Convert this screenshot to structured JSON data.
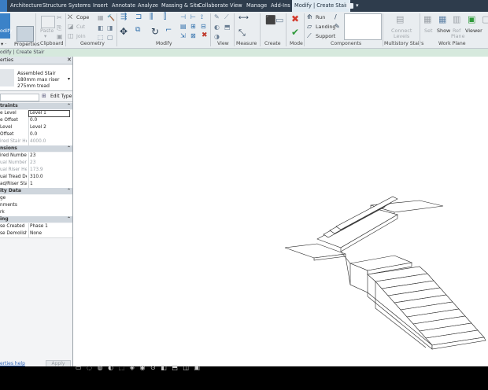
{
  "tabs": [
    "Architecture",
    "Structure",
    "Systems",
    "Insert",
    "Annotate",
    "Analyze",
    "Massing & Site",
    "Collaborate",
    "View",
    "Manage",
    "Add-Ins",
    "Modify | Create Stair"
  ],
  "ribbon": {
    "modify_label": "odify",
    "properties_label": "Properties",
    "clipboard": {
      "paste": "Paste",
      "label": "Clipboard"
    },
    "geometry": {
      "cope": "Cope",
      "cut": "Cut",
      "join": "Join",
      "label": "Geometry"
    },
    "modify_group": {
      "label": "Modify"
    },
    "view_group": {
      "label": "View"
    },
    "measure_group": {
      "label": "Measure"
    },
    "create_group": {
      "label": "Create"
    },
    "mode_group": {
      "label": "Mode"
    },
    "components": {
      "run": "Run",
      "landing": "Landing",
      "support": "Support",
      "label": "Components"
    },
    "multistory": {
      "connect": "Connect",
      "levels": "Levels",
      "label": "Multistory Stairs"
    },
    "workplane": {
      "set": "Set",
      "show": "Show",
      "ref": "Ref",
      "plane": "Plane",
      "viewer": "Viewer",
      "label": "Work Plane"
    }
  },
  "context_bar": "odify | Create Stair",
  "properties": {
    "title": "erties",
    "type_name": [
      "Assembled Stair",
      "180mm max riser",
      "275mm tread"
    ],
    "edit_type": "Edit Type",
    "sections": [
      {
        "title": "traints",
        "rows": [
          [
            "e Level",
            "Level 1"
          ],
          [
            "e Offset",
            "0.0"
          ],
          [
            "Level",
            "Level 2"
          ],
          [
            "Offset",
            "0.0"
          ],
          [
            "ired Stair He...",
            "4000.0"
          ]
        ]
      },
      {
        "title": "nsions",
        "rows": [
          [
            "ired Number...",
            "23"
          ],
          [
            "ual Number ...",
            "23"
          ],
          [
            "ual Riser He...",
            "173.9"
          ],
          [
            "ual Tread De...",
            "310.0"
          ],
          [
            "ad/Riser Star...",
            "1"
          ]
        ]
      },
      {
        "title": "ity Data",
        "rows": [
          [
            "ge",
            ""
          ],
          [
            "nments",
            ""
          ],
          [
            "rk",
            ""
          ]
        ]
      },
      {
        "title": "ing",
        "rows": [
          [
            "se Created",
            "Phase 1"
          ],
          [
            "se Demolish...",
            "None"
          ]
        ]
      }
    ],
    "help_link": "erties help",
    "apply": "Apply"
  }
}
